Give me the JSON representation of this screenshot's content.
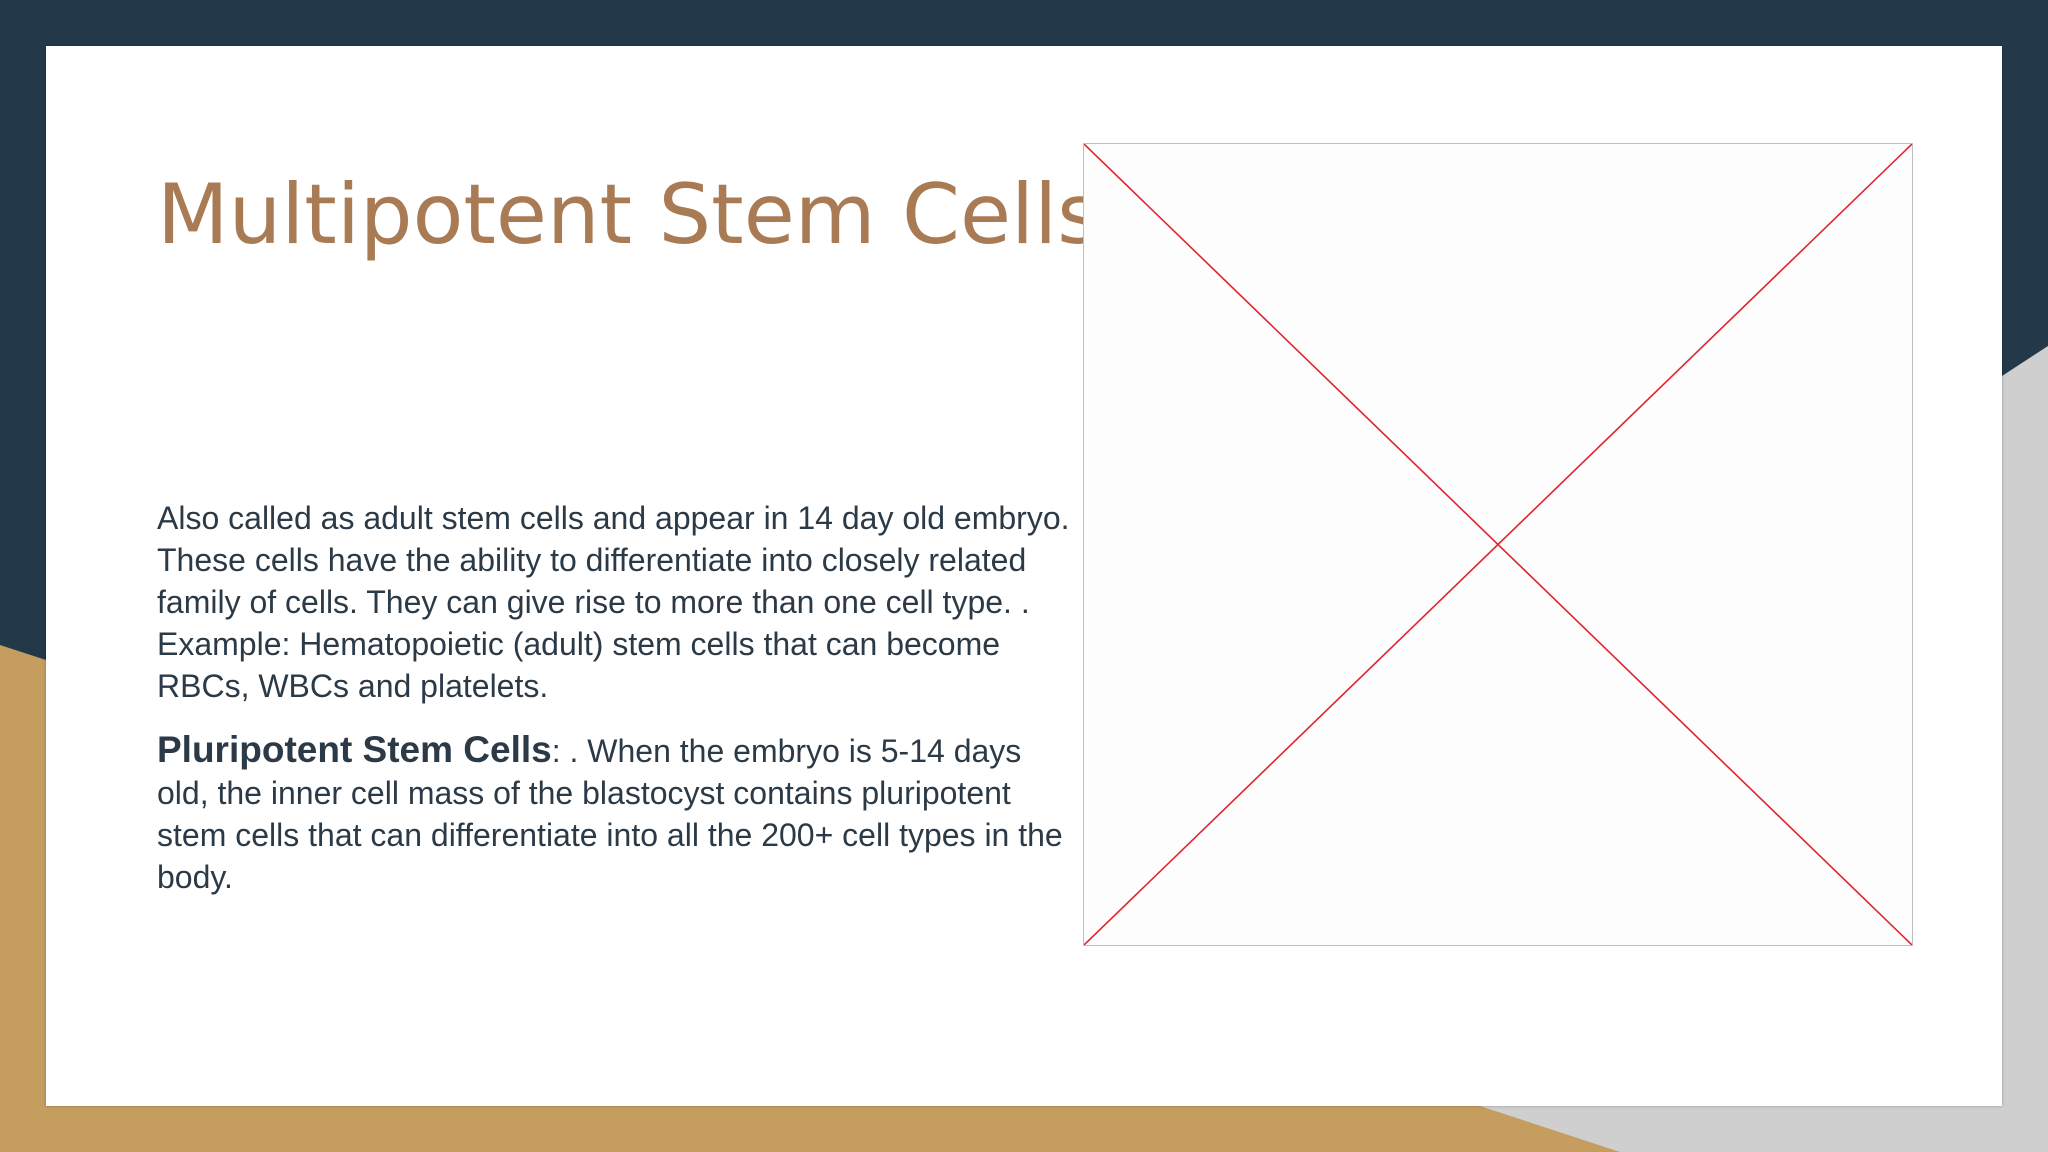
{
  "slide": {
    "title": "Multipotent Stem Cells",
    "paragraph1": "Also called as adult stem cells and appear in 14 day old embryo. These cells have the ability to differentiate into closely related family of cells. They can give rise to more than one cell type. . Example: Hematopoietic (adult) stem cells that can become RBCs, WBCs and platelets.",
    "paragraph2_term": "Pluripotent Stem Cells",
    "paragraph2_text": ": . When the embryo is 5-14 days old, the inner cell mass of the blastocyst contains pluripotent stem cells that can differentiate into all the 200+ cell types in the body."
  },
  "image_placeholder": {
    "icon": "missing-image-cross-icon",
    "line_color": "#e0242c"
  },
  "theme": {
    "navy": "#23394a",
    "gold": "#c59d5f",
    "gray": "#cfcfcf",
    "title_color": "#a97b55",
    "text_color": "#2b3a46"
  }
}
